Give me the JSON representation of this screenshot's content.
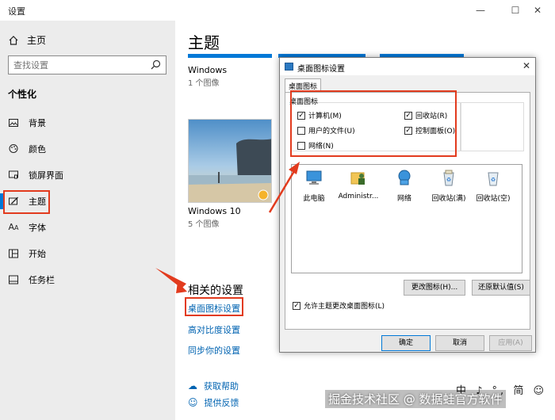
{
  "window": {
    "title": "设置",
    "controls": [
      "—",
      "☐",
      "✕"
    ]
  },
  "sidebar": {
    "home_label": "主页",
    "search_placeholder": "查找设置",
    "section_title": "个性化",
    "items": [
      {
        "label": "背景",
        "icon": "picture-icon"
      },
      {
        "label": "颜色",
        "icon": "palette-icon"
      },
      {
        "label": "锁屏界面",
        "icon": "monitor-icon"
      },
      {
        "label": "主题",
        "icon": "brush-icon"
      },
      {
        "label": "字体",
        "icon": "font-icon"
      },
      {
        "label": "开始",
        "icon": "start-grid-icon"
      },
      {
        "label": "任务栏",
        "icon": "taskbar-icon"
      }
    ],
    "active_item": "主题"
  },
  "main": {
    "title": "主题",
    "themes": [
      {
        "name": "Windows",
        "count": "1 个图像"
      },
      {
        "name": "Windows 10",
        "count": "5 个图像"
      }
    ],
    "related_title": "相关的设置",
    "links": [
      "桌面图标设置",
      "高对比度设置",
      "同步你的设置"
    ],
    "help": [
      "获取帮助",
      "提供反馈"
    ]
  },
  "dialog": {
    "title": "桌面图标设置",
    "tab": "桌面图标",
    "group_label": "桌面图标",
    "checkboxes": [
      {
        "label": "计算机(M)",
        "checked": true
      },
      {
        "label": "回收站(R)",
        "checked": true
      },
      {
        "label": "用户的文件(U)",
        "checked": false
      },
      {
        "label": "控制面板(O)",
        "checked": true
      },
      {
        "label": "网络(N)",
        "checked": false
      }
    ],
    "icons": [
      "此电脑",
      "Administr...",
      "网络",
      "回收站(满)",
      "回收站(空)"
    ],
    "change_icon": "更改图标(H)...",
    "restore_default": "还原默认值(S)",
    "allow_themes": "允许主题更改桌面图标(L)",
    "allow_themes_checked": true,
    "ok": "确定",
    "cancel": "取消",
    "apply": "应用(A)"
  },
  "overlay": {
    "watermark": "掘金技术社区 @ 数据蛙官方软件",
    "ime": "中 ♪ °, 简 ☺"
  },
  "colors": {
    "accent": "#0078d7",
    "highlight": "#e23b1e",
    "sidebar": "#ececec",
    "link": "#0063b1"
  }
}
